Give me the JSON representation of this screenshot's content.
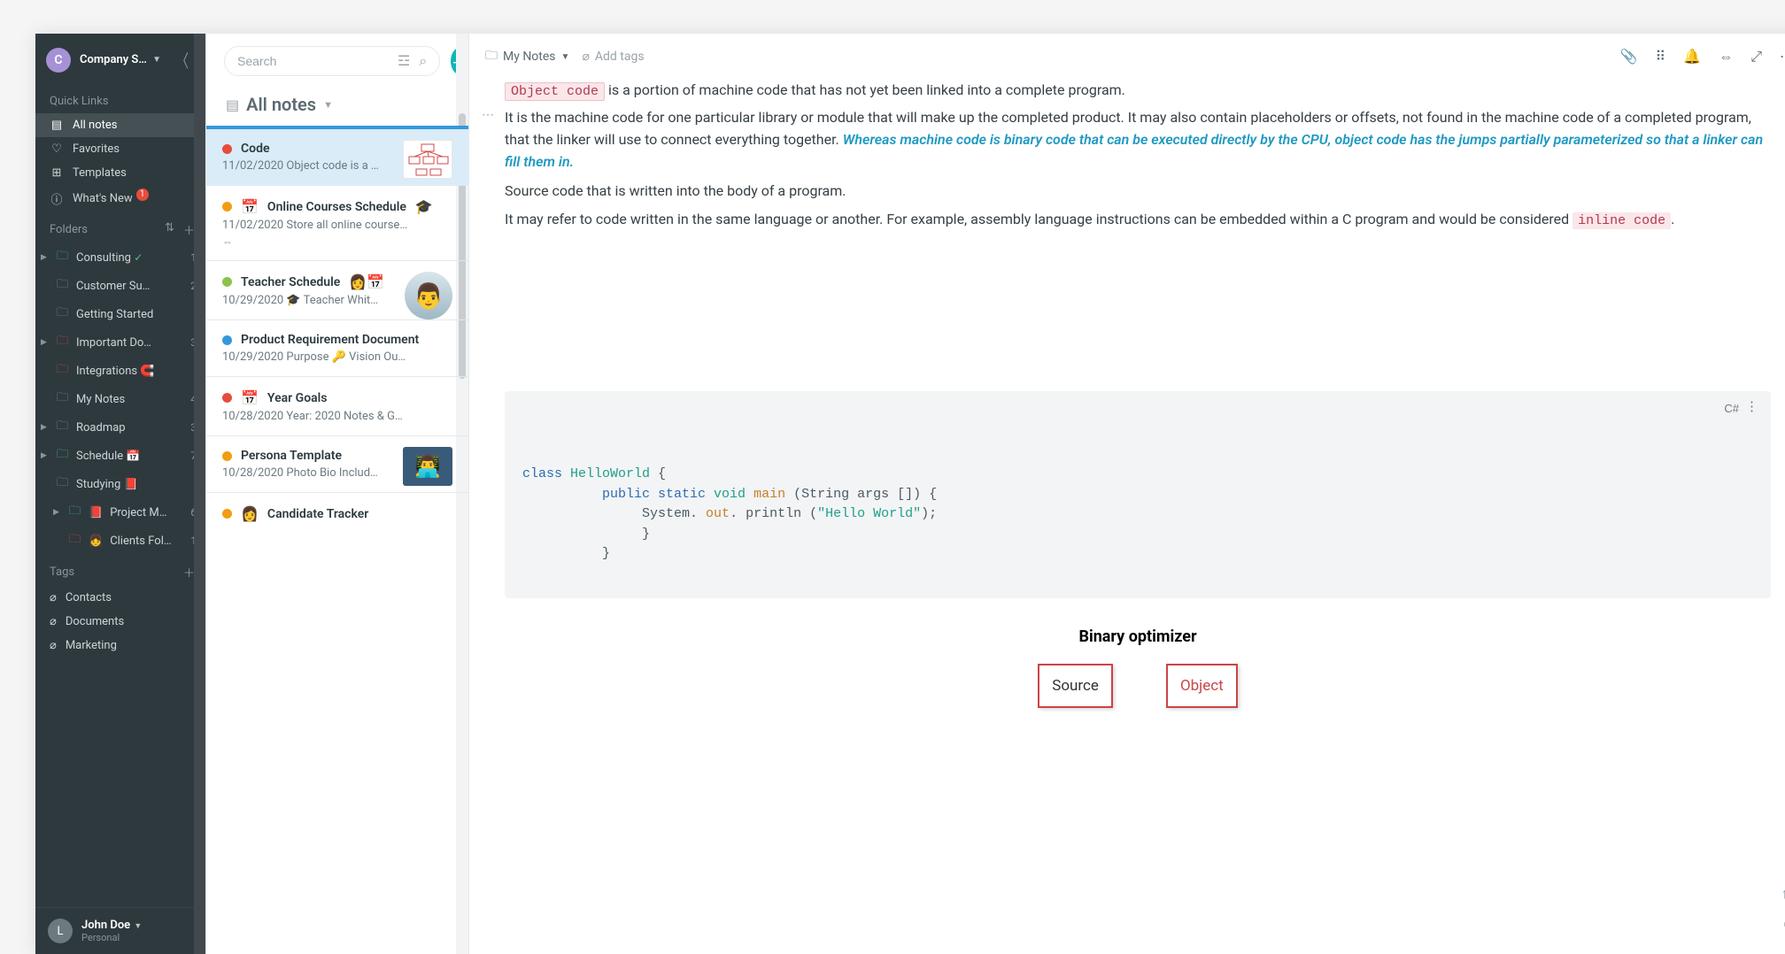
{
  "workspace": {
    "avatar_initial": "C",
    "name": "Company Sh…"
  },
  "quick_links": {
    "title": "Quick Links",
    "items": [
      {
        "icon": "📄",
        "label": "All notes"
      },
      {
        "icon": "♡",
        "label": "Favorites"
      },
      {
        "icon": "⊞",
        "label": "Templates"
      },
      {
        "icon": "ⓘ",
        "label": "What's New",
        "badge": "1"
      }
    ]
  },
  "folders": {
    "title": "Folders",
    "items": [
      {
        "expandable": true,
        "color": "folder-teal",
        "label": "Consulting",
        "suffix_icon": "✓",
        "count": "1"
      },
      {
        "expandable": false,
        "color": "folder-gray",
        "label": "Customer Su…",
        "count": "2"
      },
      {
        "expandable": false,
        "color": "folder-gray",
        "label": "Getting Started",
        "count": ""
      },
      {
        "expandable": true,
        "color": "folder-red",
        "label": "Important Do…",
        "count": "3"
      },
      {
        "expandable": false,
        "color": "folder-red",
        "label": "Integrations",
        "suffix_emoji": "🧲",
        "count": ""
      },
      {
        "expandable": false,
        "color": "folder-gray",
        "label": "My Notes",
        "count": "4"
      },
      {
        "expandable": true,
        "color": "folder-gray",
        "label": "Roadmap",
        "count": "3"
      },
      {
        "expandable": true,
        "color": "folder-green",
        "label": "Schedule",
        "suffix_emoji": "📅",
        "count": "7"
      },
      {
        "expandable": false,
        "color": "folder-gray",
        "label": "Studying",
        "suffix_emoji": "📕",
        "count": ""
      },
      {
        "expandable": true,
        "sub": true,
        "color": "folder-teal",
        "pre_emoji": "📕",
        "label": "Project M…",
        "count": "6"
      },
      {
        "expandable": false,
        "sub": true,
        "color": "folder-red",
        "pre_emoji": "👧",
        "label": "Clients Fol…",
        "count": "1"
      }
    ]
  },
  "tags": {
    "title": "Tags",
    "items": [
      "Contacts",
      "Documents",
      "Marketing"
    ]
  },
  "user": {
    "avatar_initial": "L",
    "name": "John Doe",
    "account": "Personal"
  },
  "search": {
    "placeholder": "Search"
  },
  "list": {
    "title": "All notes",
    "items": [
      {
        "color": "#e74c3c",
        "title": "Code",
        "date": "11/02/2020",
        "preview": "Object code is a …",
        "thumb": "diagram",
        "selected": true
      },
      {
        "color": "#f39c12",
        "pre_emoji": "📅",
        "title": "Online Courses Schedule",
        "suffix_emoji": "🎓",
        "date": "11/02/2020",
        "preview": "Store all online courses that ar…",
        "share": true
      },
      {
        "color": "#8bc34a",
        "title": "Teacher Schedule",
        "suffix_emoji": "👩📅",
        "date": "10/29/2020",
        "preview": "🎓 Teacher Whit…",
        "thumb": "avatar1"
      },
      {
        "color": "#3498db",
        "title": "Product Requirement Document",
        "date": "10/29/2020",
        "preview": "Purpose 🔑 Vision Our produc…"
      },
      {
        "color": "#e74c3c",
        "pre_emoji": "📅",
        "title": "Year Goals",
        "date": "10/28/2020",
        "preview": "Year: 2020 Notes & Goals Janu…"
      },
      {
        "color": "#f39c12",
        "title": "Persona Template",
        "date": "10/28/2020",
        "preview": "Photo Bio Includ…",
        "thumb": "avatar2"
      },
      {
        "color": "#f39c12",
        "pre_emoji": "👩",
        "title": "Candidate Tracker",
        "date": "",
        "preview": ""
      }
    ]
  },
  "editor": {
    "breadcrumb_folder": "My Notes",
    "add_tags": "Add tags",
    "content": {
      "il1": "Object code",
      "p1_tail": " is a portion of machine code that has not yet been linked into a complete program.",
      "p2_pre": "It is the machine code for one particular library or module that will make up the completed product. It may also contain placeholders or offsets, not found in the machine code of a completed program, that the linker will use to connect everything together. ",
      "p2_em": "Whereas machine code is binary code that can be executed directly by the CPU, object code has the jumps partially parameterized so that a linker can fill them in.",
      "p3": "Source code that is written into the body of a program.",
      "p4_pre": "It may refer to code written in the same language or another. For example, assembly language instructions can be embedded within a C program and would be considered ",
      "il2": "inline code",
      "p4_post": "."
    },
    "code_lang": "C#",
    "code": {
      "l1a": "class ",
      "l1b": "HelloWorld ",
      "l1c": "{",
      "l2a": "public static ",
      "l2b": "void ",
      "l2c": "main ",
      "l2d": "(String args []) {",
      "l3a": "System. ",
      "l3b": "out",
      "l3c": ". println (",
      "l3d": "\"Hello World\"",
      "l3e": ");",
      "l4": "}",
      "l5": "}"
    },
    "diagram_title": "Binary optimizer",
    "diagram_box1": "Source",
    "diagram_box2": "Object"
  }
}
